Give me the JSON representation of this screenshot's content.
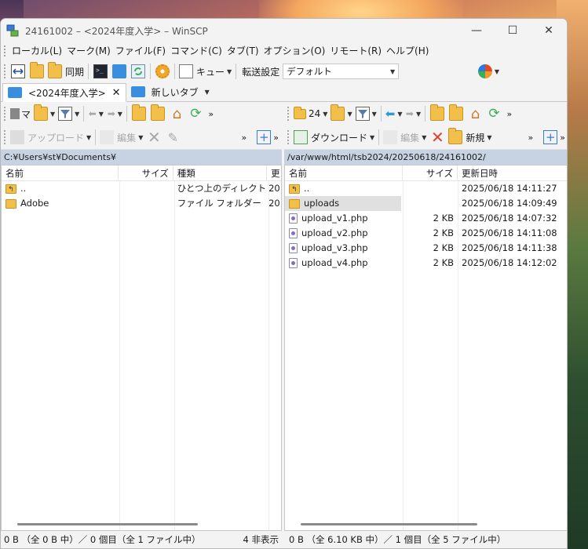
{
  "window": {
    "title": "24161002 – <2024年度入学> – WinSCP",
    "minimize": "—",
    "maximize": "☐",
    "close": "✕"
  },
  "menu": [
    "ローカル(L)",
    "マーク(M)",
    "ファイル(F)",
    "コマンド(C)",
    "タブ(T)",
    "オプション(O)",
    "リモート(R)",
    "ヘルプ(H)"
  ],
  "toolbar": {
    "sync_label": "同期",
    "queue_label": "キュー",
    "transfer_label": "転送設定",
    "transfer_value": "デフォルト"
  },
  "tabs": {
    "session": "<2024年度入学>",
    "new_tab": "新しいタブ"
  },
  "left": {
    "path_combo": "マ",
    "upload_label": "アップロード",
    "edit_label": "編集",
    "path": "C:¥Users¥st¥Documents¥",
    "columns": [
      "名前",
      "サイズ",
      "種類",
      "更"
    ],
    "rows": [
      {
        "name": "..",
        "size": "",
        "type": "ひとつ上のディレクトリ",
        "changed": "20",
        "icon": "up"
      },
      {
        "name": "Adobe",
        "size": "",
        "type": "ファイル フォルダー",
        "changed": "20",
        "icon": "folder"
      }
    ],
    "status_left": "0 B （全 0 B 中）／ 0 個目（全 1 ファイル中）",
    "status_right": "4 非表示"
  },
  "right": {
    "path_combo": "24",
    "download_label": "ダウンロード",
    "edit_label": "編集",
    "new_label": "新規",
    "path": "/var/www/html/tsb2024/20250618/24161002/",
    "columns": [
      "名前",
      "サイズ",
      "更新日時"
    ],
    "rows": [
      {
        "name": "..",
        "size": "",
        "changed": "2025/06/18 14:11:27",
        "icon": "up"
      },
      {
        "name": "uploads",
        "size": "",
        "changed": "2025/06/18 14:09:49",
        "icon": "folder"
      },
      {
        "name": "upload_v1.php",
        "size": "2 KB",
        "changed": "2025/06/18 14:07:32",
        "icon": "php"
      },
      {
        "name": "upload_v2.php",
        "size": "2 KB",
        "changed": "2025/06/18 14:11:08",
        "icon": "php"
      },
      {
        "name": "upload_v3.php",
        "size": "2 KB",
        "changed": "2025/06/18 14:11:38",
        "icon": "php"
      },
      {
        "name": "upload_v4.php",
        "size": "2 KB",
        "changed": "2025/06/18 14:12:02",
        "icon": "php"
      }
    ],
    "status": "0 B （全 6.10 KB 中）／ 1 個目（全 5 ファイル中）"
  }
}
